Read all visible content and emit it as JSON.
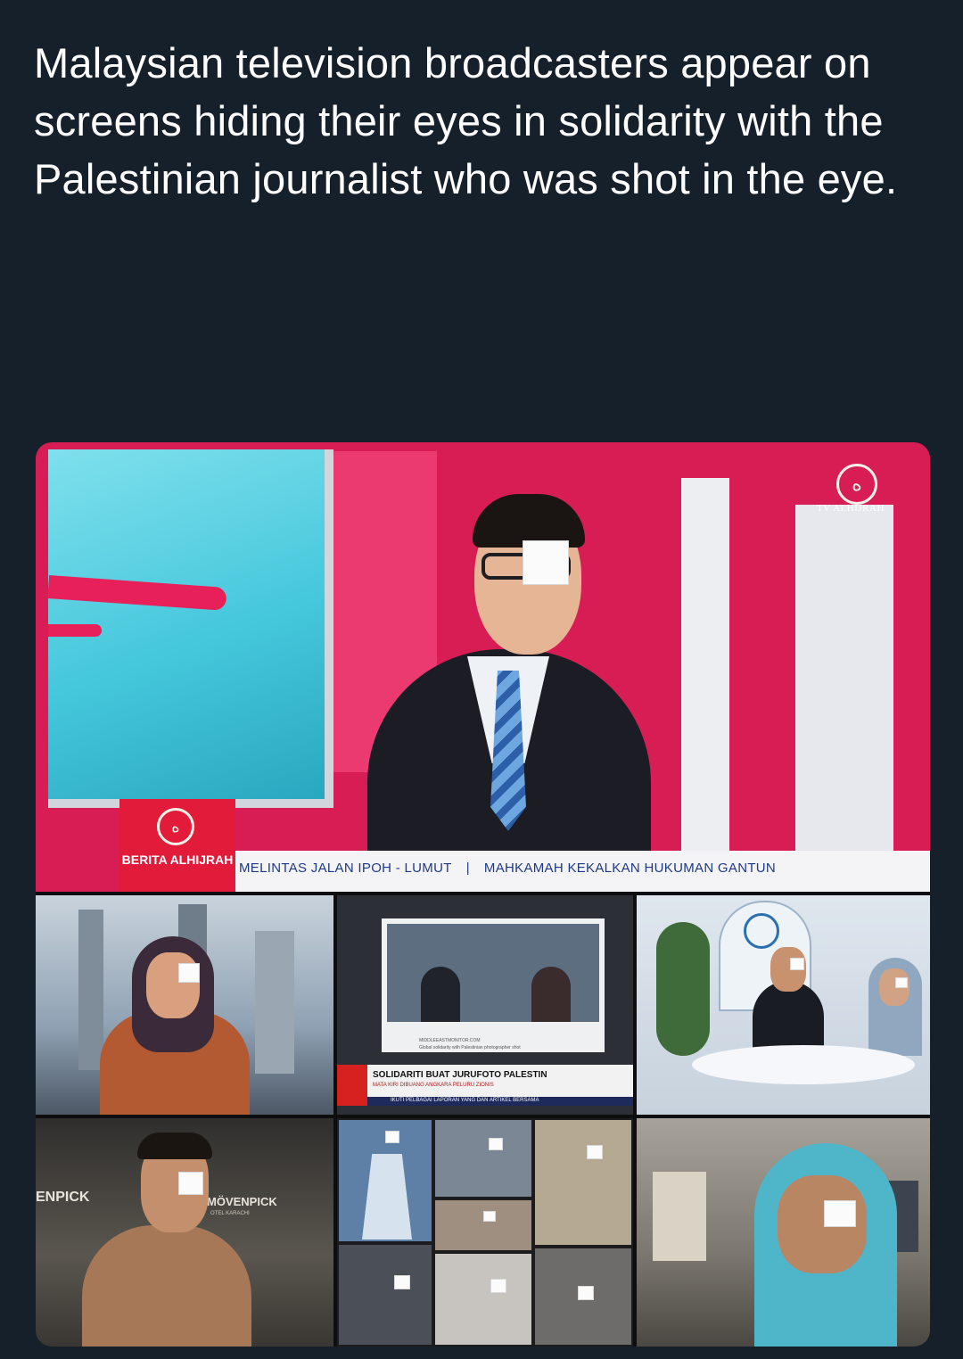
{
  "caption": "Malaysian television broadcasters appear on screens hiding their eyes in solidarity with the Palestinian journalist who was shot in the eye.",
  "main_panel": {
    "channel_watermark": "TV ALHIJRAH",
    "program_label": "BERITA ALHIJRAH",
    "ticker": {
      "item1": "MELINTAS JALAN IPOH - LUMUT",
      "separator": "|",
      "item2": "MAHKAMAH KEKALKAN HUKUMAN GANTUN"
    }
  },
  "panel_news": {
    "headline": "SOLIDARITI BUAT JURUFOTO PALESTIN",
    "subheadline": "MATA KIRI DIBUANG ANGKARA PELURU ZIONIS",
    "source": "MIDDLEEASTMONITOR.COM",
    "web_title": "Global solidarity with Palestinian photographer shot",
    "ticker": "IKUTI PELBAGAI LAPORAN YANG DAN ARTIKEL BERSAMA"
  },
  "panel_hotel": {
    "sign_left": "ENPICK",
    "sign_right": "MÖVENPICK",
    "sign_sub": "OTEL KARACHI"
  },
  "colors": {
    "page_background": "#15202b",
    "studio_pink": "#d81d55",
    "ticker_blue": "#1e3a86",
    "lower_third_red": "#e31b3b"
  },
  "icons": {
    "channel_logo": "alhijrah-logo-icon",
    "studio_logo": "astro-a-logo-icon"
  }
}
